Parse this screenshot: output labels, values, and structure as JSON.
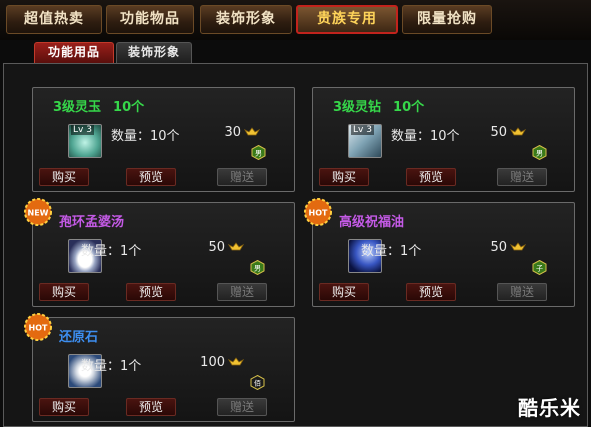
{
  "tabs": [
    "超值热卖",
    "功能物品",
    "装饰形象",
    "贵族专用",
    "限量抢购"
  ],
  "subtabs": [
    "功能用品",
    "装饰形象"
  ],
  "items": [
    {
      "title": "3级灵玉",
      "count": "10个",
      "level": "Lv 3",
      "qty_label": "数量：10个",
      "price": "30",
      "gender": "男",
      "badge": "",
      "buy": "购买",
      "preview": "预览",
      "gift": "赠送",
      "title_color": "#36d84a"
    },
    {
      "title": "3级灵钻",
      "count": "10个",
      "level": "Lv 3",
      "qty_label": "数量：10个",
      "price": "50",
      "gender": "男",
      "badge": "",
      "buy": "购买",
      "preview": "预览",
      "gift": "赠送",
      "title_color": "#36d84a"
    },
    {
      "title": "孢环孟婆汤",
      "count": "",
      "level": "",
      "qty_label": "数量：1个",
      "price": "50",
      "gender": "男",
      "badge": "NEW",
      "buy": "购买",
      "preview": "预览",
      "gift": "赠送",
      "title_color": "#c45ae6"
    },
    {
      "title": "高级祝福油",
      "count": "",
      "level": "",
      "qty_label": "数量：1个",
      "price": "50",
      "gender": "子",
      "badge": "HOT",
      "buy": "购买",
      "preview": "预览",
      "gift": "赠送",
      "title_color": "#c45ae6"
    },
    {
      "title": "还原石",
      "count": "",
      "level": "",
      "qty_label": "数量：1个",
      "price": "100",
      "gender": "佰",
      "badge": "HOT",
      "buy": "购买",
      "preview": "预览",
      "gift": "赠送",
      "title_color": "#3d8ef0"
    }
  ],
  "watermark": "酷乐米"
}
